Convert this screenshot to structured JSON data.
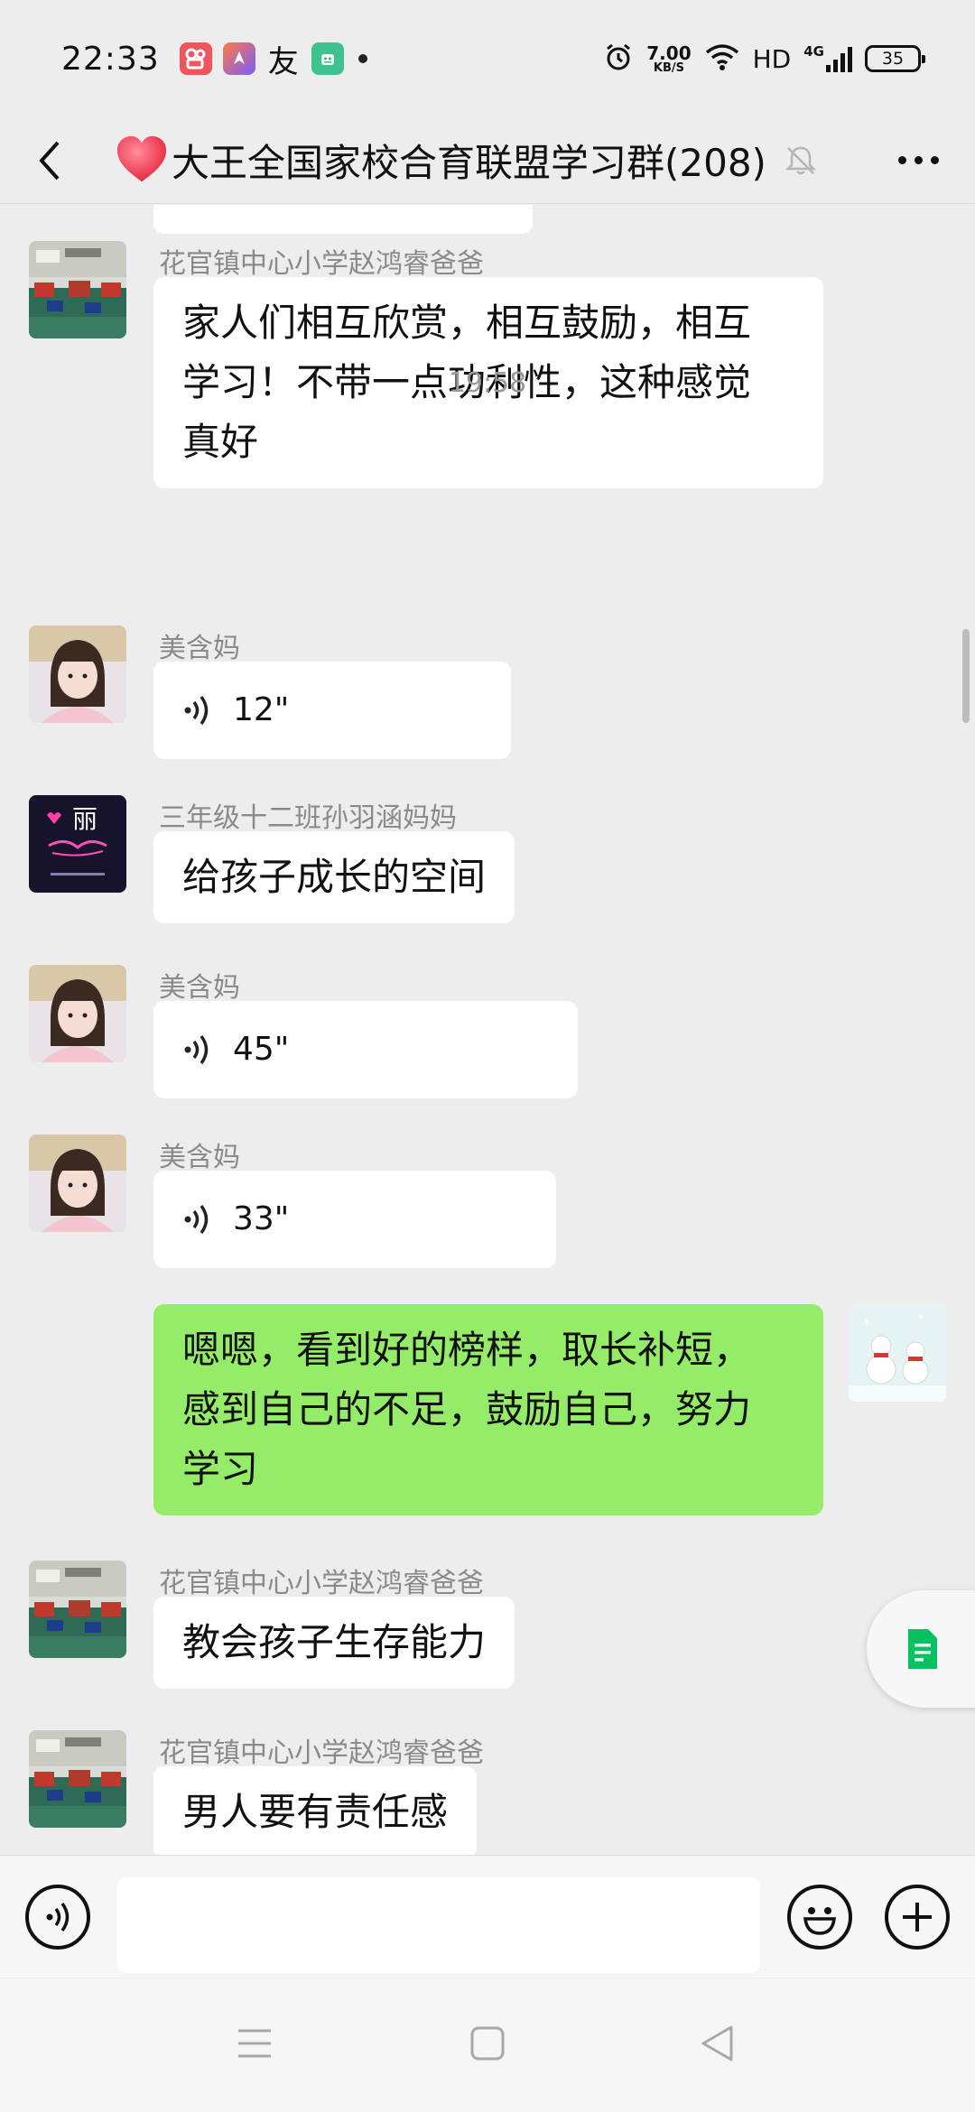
{
  "status_bar": {
    "time": "22:33",
    "notif_icons": [
      "kuaishou-icon",
      "bookmark-app-icon",
      "text-app-icon",
      "robot-app-icon"
    ],
    "net_speed_value": "7.00",
    "net_speed_unit": "KB/S",
    "hd": "HD",
    "network": "4G",
    "battery": "35"
  },
  "header": {
    "title": "大王全国家校合育联盟学习群(208)"
  },
  "messages": [
    {
      "sender": "花官镇中心小学赵鸿睿爸爸",
      "text_lines": [
        "家人们相互欣赏，相互鼓励，相互",
        "学习！不带一点功利性，这种感觉",
        "真好"
      ]
    },
    {
      "timestamp": "19:58"
    },
    {
      "sender": "美含妈",
      "voice": "12\""
    },
    {
      "sender": "三年级十二班孙羽涵妈妈",
      "text": "给孩子成长的空间",
      "avatar_text": "丽"
    },
    {
      "sender": "美含妈",
      "voice": "45\""
    },
    {
      "sender": "美含妈",
      "voice": "33\""
    },
    {
      "self": true,
      "text_lines": [
        "嗯嗯，看到好的榜样，取长补短，",
        "感到自己的不足，鼓励自己，努力",
        "学习"
      ]
    },
    {
      "sender": "花官镇中心小学赵鸿睿爸爸",
      "text": "教会孩子生存能力"
    },
    {
      "sender": "花官镇中心小学赵鸿睿爸爸",
      "text": "男人要有责任感"
    }
  ],
  "colors": {
    "background": "#ededed",
    "self_bubble": "#95ec69",
    "other_bubble": "#ffffff",
    "accent_green": "#07c160"
  }
}
